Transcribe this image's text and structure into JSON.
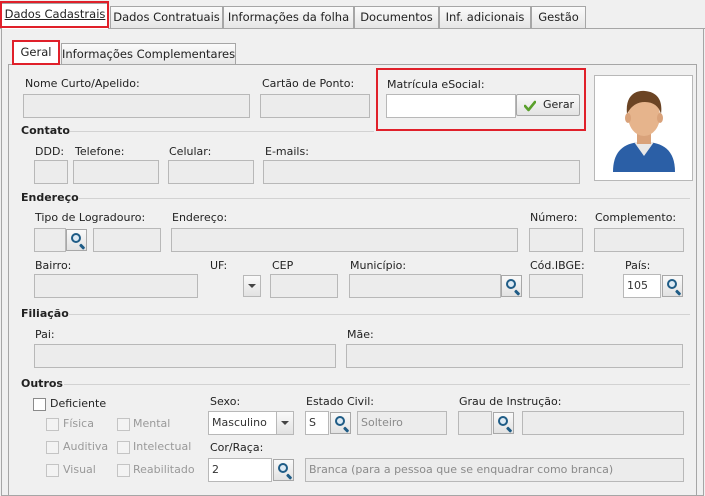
{
  "top_tabs": [
    {
      "label": "Dados Cadastrais",
      "active": true
    },
    {
      "label": "Dados Contratuais",
      "active": false
    },
    {
      "label": "Informações da folha",
      "active": false
    },
    {
      "label": "Documentos",
      "active": false
    },
    {
      "label": "Inf. adicionais",
      "active": false
    },
    {
      "label": "Gestão",
      "active": false
    }
  ],
  "sub_tabs": [
    {
      "label": "Geral",
      "active": true
    },
    {
      "label": "Informações Complementares",
      "active": false
    }
  ],
  "geral": {
    "nome_curto_label": "Nome Curto/Apelido:",
    "cartao_ponto_label": "Cartão de Ponto:",
    "matricula_esocial_label": "Matrícula eSocial:",
    "gerar_label": "Gerar"
  },
  "contato": {
    "title": "Contato",
    "ddd_label": "DDD:",
    "telefone_label": "Telefone:",
    "celular_label": "Celular:",
    "emails_label": "E-mails:"
  },
  "endereco": {
    "title": "Endereço",
    "tipo_logradouro_label": "Tipo de Logradouro:",
    "endereco_label": "Endereço:",
    "numero_label": "Número:",
    "complemento_label": "Complemento:",
    "bairro_label": "Bairro:",
    "uf_label": "UF:",
    "cep_label": "CEP",
    "municipio_label": "Município:",
    "cod_ibge_label": "Cód.IBGE:",
    "pais_label": "País:",
    "pais_value": "105"
  },
  "filiacao": {
    "title": "Filiação",
    "pai_label": "Pai:",
    "mae_label": "Mãe:"
  },
  "outros": {
    "title": "Outros",
    "deficiente_label": "Deficiente",
    "fisica_label": "Física",
    "mental_label": "Mental",
    "auditiva_label": "Auditiva",
    "intelectual_label": "Intelectual",
    "visual_label": "Visual",
    "reabilitado_label": "Reabilitado",
    "sexo_label": "Sexo:",
    "sexo_value": "Masculino",
    "estado_civil_label": "Estado Civil:",
    "estado_civil_code": "S",
    "estado_civil_desc": "Solteiro",
    "grau_instrucao_label": "Grau de Instrução:",
    "cor_raca_label": "Cor/Raça:",
    "cor_raca_code": "2",
    "cor_raca_desc": "Branca (para a pessoa que se enquadrar como branca)"
  },
  "colors": {
    "highlight": "#e0202a",
    "gerar_check": "#5aa02c",
    "lens": "#1f5c86"
  }
}
